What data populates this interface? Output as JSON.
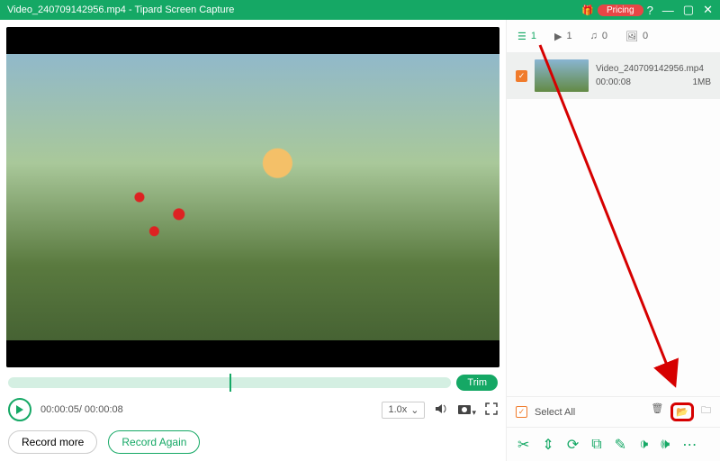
{
  "titlebar": {
    "filename": "Video_240709142956.mp4",
    "separator": " - ",
    "appname": "Tipard Screen Capture",
    "gift": "🎁",
    "pricing": "Pricing"
  },
  "tabs": {
    "list_count": "1",
    "video_count": "1",
    "audio_count": "0",
    "image_count": "0"
  },
  "item": {
    "name": "Video_240709142956.mp4",
    "duration": "00:00:08",
    "size": "1MB"
  },
  "trim": {
    "label": "Trim"
  },
  "controls": {
    "time": "00:00:05/ 00:00:08",
    "speed": "1.0x"
  },
  "buttons": {
    "record_more": "Record more",
    "record_again": "Record Again"
  },
  "selectall": {
    "label": "Select All"
  }
}
